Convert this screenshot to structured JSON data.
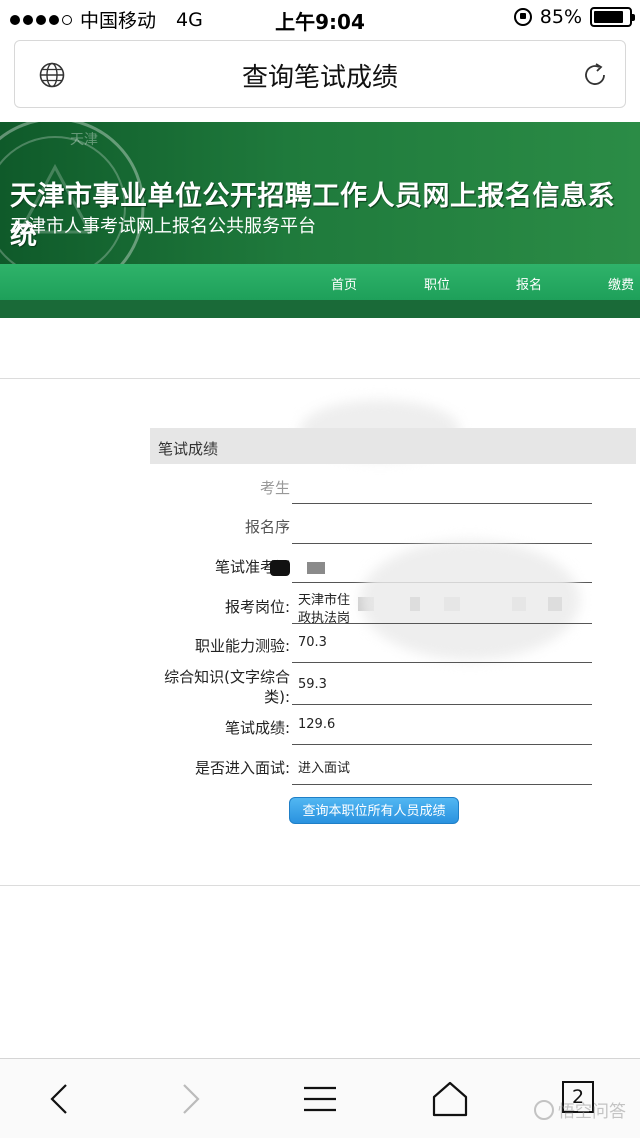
{
  "status_bar": {
    "carrier": "中国移动",
    "network": "4G",
    "time": "上午9:04",
    "battery": "85%",
    "battery_level": 0.85
  },
  "address_bar": {
    "title": "查询笔试成绩"
  },
  "header": {
    "title": "天津市事业单位公开招聘工作人员网上报名信息系统",
    "subtitle": "天津市人事考试网上报名公共服务平台",
    "seal_text": "天津"
  },
  "nav": {
    "items": [
      {
        "label": "首页"
      },
      {
        "label": "职位"
      },
      {
        "label": "报名"
      },
      {
        "label": "缴费"
      }
    ]
  },
  "score_panel": {
    "heading": "笔试成绩",
    "fields": [
      {
        "label": "考生",
        "value": ""
      },
      {
        "label": "报名序",
        "value": ""
      },
      {
        "label": "笔试准考证",
        "value": ""
      },
      {
        "label": "报考岗位:",
        "value": "天津市住",
        "value2": "政执法岗"
      },
      {
        "label": "职业能力测验:",
        "value": "70.3"
      },
      {
        "label": "综合知识(文字综合",
        "label2": "类):",
        "value": "59.3"
      },
      {
        "label": "笔试成绩:",
        "value": "129.6"
      },
      {
        "label": "是否进入面试:",
        "value": "进入面试"
      }
    ],
    "query_button": "查询本职位所有人员成绩"
  },
  "toolbar": {
    "tab_count": "2",
    "watermark": "悟空问答"
  },
  "colors": {
    "banner": "#1f7a3c",
    "nav": "#2fb36a",
    "button": "#2a92df"
  }
}
